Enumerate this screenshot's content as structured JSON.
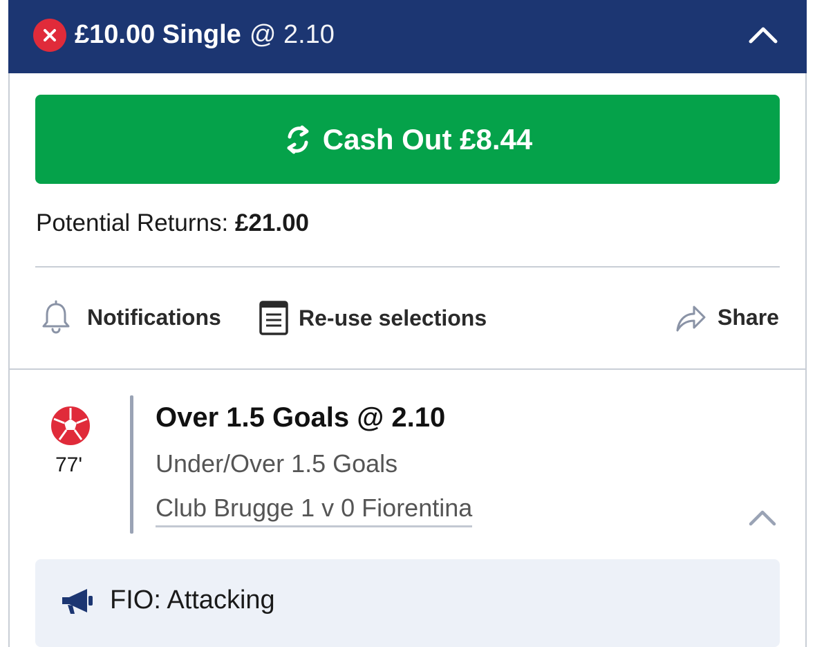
{
  "header": {
    "stake_type": "£10.00 Single",
    "odds": "@ 2.10",
    "close_icon": "close-icon",
    "collapse_icon": "chevron-up-icon"
  },
  "cashout": {
    "label": "Cash Out £8.44",
    "icon": "refresh-icon",
    "color": "#05a24a"
  },
  "returns": {
    "label": "Potential Returns:",
    "value": "£21.00"
  },
  "actions": {
    "notifications": "Notifications",
    "reuse": "Re-use selections",
    "share": "Share"
  },
  "selection": {
    "minute": "77'",
    "title": "Over 1.5 Goals @ 2.10",
    "market": "Under/Over 1.5 Goals",
    "event": "Club Brugge 1 v 0 Fiorentina"
  },
  "commentary": {
    "text": "FIO: Attacking"
  },
  "colors": {
    "header_bg": "#1c3672",
    "close_badge": "#e02b3a",
    "commentary_bg": "#edf1f8"
  }
}
